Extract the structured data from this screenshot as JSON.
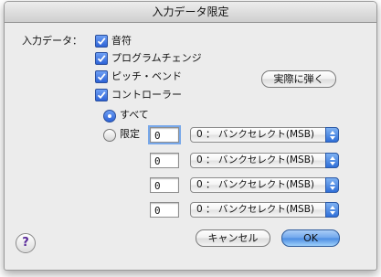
{
  "window": {
    "title": "入力データ限定"
  },
  "input_data": {
    "label": "入力データ：",
    "checkboxes": [
      {
        "label": "音符",
        "checked": true
      },
      {
        "label": "プログラムチェンジ",
        "checked": true
      },
      {
        "label": "ピッチ・ベンド",
        "checked": true
      },
      {
        "label": "コントローラー",
        "checked": true
      }
    ]
  },
  "play_button": {
    "label": "実際に弾く"
  },
  "scope": {
    "all_label": "すべて",
    "limited_label": "限定",
    "selected": "all"
  },
  "controller_rows": [
    {
      "value": "0",
      "select": "0 ： バンクセレクト(MSB)"
    },
    {
      "value": "0",
      "select": "0 ： バンクセレクト(MSB)"
    },
    {
      "value": "0",
      "select": "0 ： バンクセレクト(MSB)"
    },
    {
      "value": "0",
      "select": "0 ： バンクセレクト(MSB)"
    }
  ],
  "buttons": {
    "cancel": "キャンセル",
    "ok": "OK"
  },
  "help": {
    "glyph": "?"
  },
  "colors": {
    "accent": "#3b78e0"
  }
}
